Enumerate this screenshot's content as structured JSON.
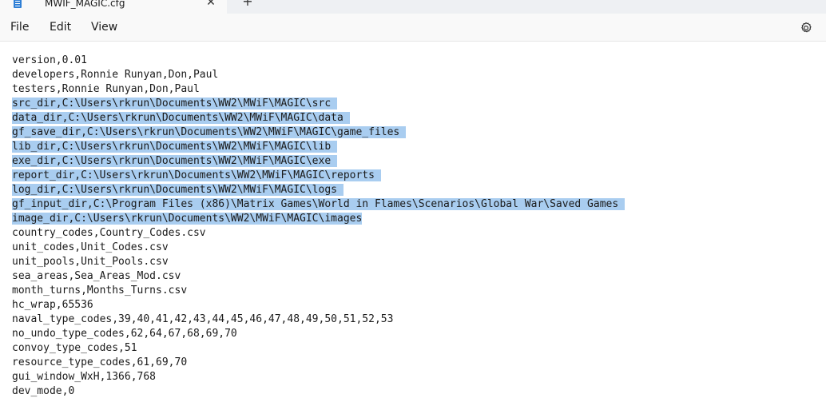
{
  "tab": {
    "title": "MWIF_MAGIC.cfg",
    "icon": "notepad-document-icon",
    "close_glyph": "✕",
    "new_tab_glyph": "+"
  },
  "menu": {
    "file": "File",
    "edit": "Edit",
    "view": "View",
    "settings_icon": "gear-icon"
  },
  "colors": {
    "selection": "#a9cdf0",
    "menubar_bg": "#f9f9f9",
    "tabstrip_bg": "#eef0f3",
    "text": "#1a1a1a"
  },
  "editor": {
    "lines": [
      {
        "text": "version,0.01",
        "selected": false
      },
      {
        "text": "developers,Ronnie Runyan,Don,Paul",
        "selected": false
      },
      {
        "text": "testers,Ronnie Runyan,Don,Paul",
        "selected": false
      },
      {
        "text": "src_dir,C:\\Users\\rkrun\\Documents\\WW2\\MWiF\\MAGIC\\src ",
        "selected": true
      },
      {
        "text": "data_dir,C:\\Users\\rkrun\\Documents\\WW2\\MWiF\\MAGIC\\data ",
        "selected": true
      },
      {
        "text": "gf_save_dir,C:\\Users\\rkrun\\Documents\\WW2\\MWiF\\MAGIC\\game_files ",
        "selected": true
      },
      {
        "text": "lib_dir,C:\\Users\\rkrun\\Documents\\WW2\\MWiF\\MAGIC\\lib ",
        "selected": true
      },
      {
        "text": "exe_dir,C:\\Users\\rkrun\\Documents\\WW2\\MWiF\\MAGIC\\exe ",
        "selected": true
      },
      {
        "text": "report_dir,C:\\Users\\rkrun\\Documents\\WW2\\MWiF\\MAGIC\\reports ",
        "selected": true
      },
      {
        "text": "log_dir,C:\\Users\\rkrun\\Documents\\WW2\\MWiF\\MAGIC\\logs ",
        "selected": true
      },
      {
        "text": "gf_input_dir,C:\\Program Files (x86)\\Matrix Games\\World in Flames\\Scenarios\\Global War\\Saved Games ",
        "selected": true
      },
      {
        "text": "image_dir,C:\\Users\\rkrun\\Documents\\WW2\\MWiF\\MAGIC\\images",
        "selected": true
      },
      {
        "text": "country_codes,Country_Codes.csv",
        "selected": false
      },
      {
        "text": "unit_codes,Unit_Codes.csv",
        "selected": false
      },
      {
        "text": "unit_pools,Unit_Pools.csv",
        "selected": false
      },
      {
        "text": "sea_areas,Sea_Areas_Mod.csv",
        "selected": false
      },
      {
        "text": "month_turns,Months_Turns.csv",
        "selected": false
      },
      {
        "text": "hc_wrap,65536",
        "selected": false
      },
      {
        "text": "naval_type_codes,39,40,41,42,43,44,45,46,47,48,49,50,51,52,53",
        "selected": false
      },
      {
        "text": "no_undo_type_codes,62,64,67,68,69,70",
        "selected": false
      },
      {
        "text": "convoy_type_codes,51",
        "selected": false
      },
      {
        "text": "resource_type_codes,61,69,70",
        "selected": false
      },
      {
        "text": "gui_window_WxH,1366,768",
        "selected": false
      },
      {
        "text": "dev_mode,0",
        "selected": false
      }
    ]
  }
}
